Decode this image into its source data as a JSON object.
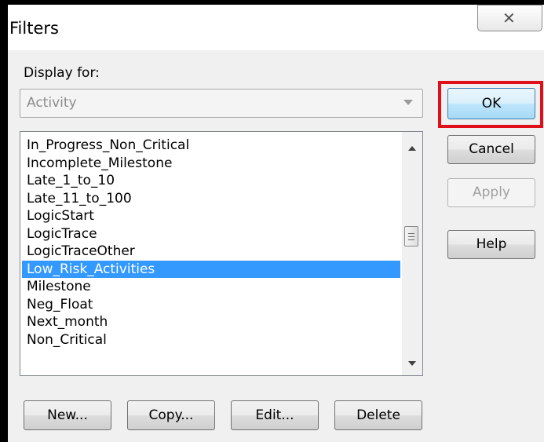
{
  "window": {
    "title": "Filters",
    "close_glyph": "X"
  },
  "display_for": {
    "label": "Display for:",
    "value": "Activity"
  },
  "filter_list": {
    "items": [
      "In_Progress_Non_Critical",
      "Incomplete_Milestone",
      "Late_1_to_10",
      "Late_11_to_100",
      "LogicStart",
      "LogicTrace",
      "LogicTraceOther",
      "Low_Risk_Activities",
      "Milestone",
      "Neg_Float",
      "Next_month",
      "Non_Critical"
    ],
    "selected_index": 7
  },
  "side_buttons": {
    "ok": "OK",
    "cancel": "Cancel",
    "apply": "Apply",
    "help": "Help"
  },
  "bottom_buttons": {
    "new": "New...",
    "copy": "Copy...",
    "edit": "Edit...",
    "delete": "Delete"
  },
  "colors": {
    "selection": "#3399ff",
    "highlight_box": "#e0101a"
  }
}
